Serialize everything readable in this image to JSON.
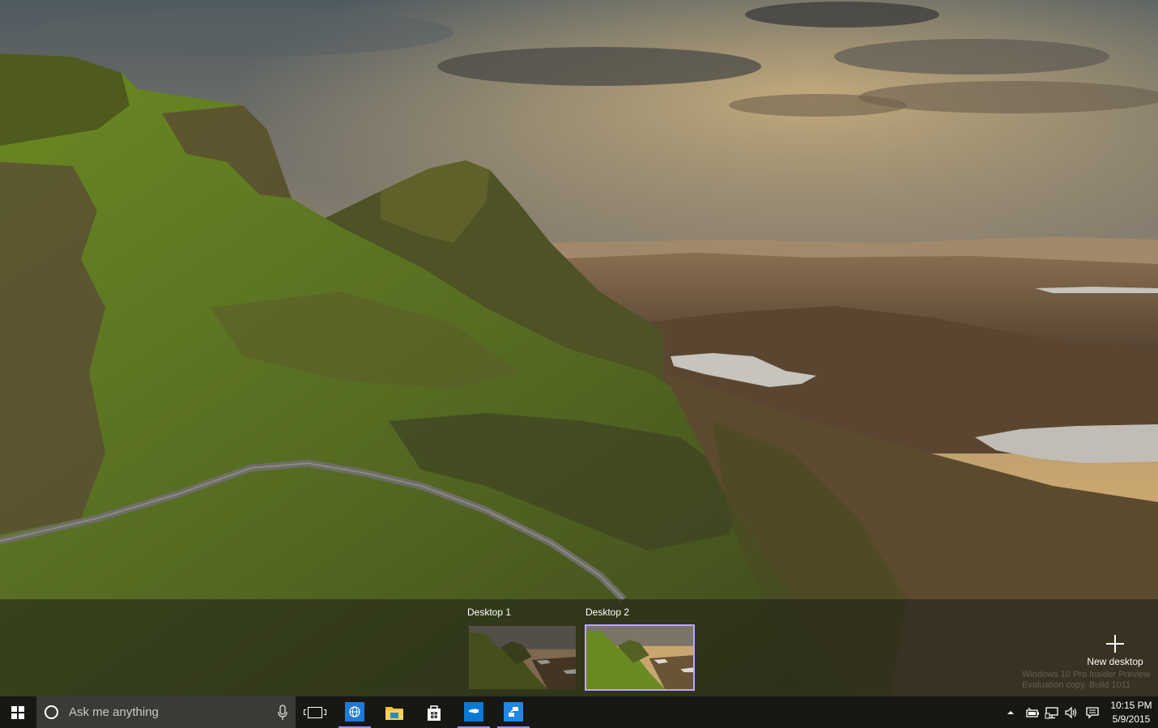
{
  "taskview": {
    "desktops": [
      {
        "label": "Desktop 1",
        "active": false
      },
      {
        "label": "Desktop 2",
        "active": true
      }
    ],
    "new_desktop_label": "New desktop"
  },
  "watermark": {
    "line1": "Windows 10 Pro Insider Preview",
    "line2": "Evaluation copy. Build 1011"
  },
  "taskbar": {
    "search_placeholder": "Ask me anything",
    "apps": [
      {
        "name": "browser",
        "color": "#1e7cd8",
        "icon": "globe-icon"
      },
      {
        "name": "file-explorer",
        "color": "#f2c12e",
        "icon": "folder-icon"
      },
      {
        "name": "store",
        "color": "#ffffff",
        "icon": "shopping-bag-icon"
      },
      {
        "name": "app-blue",
        "color": "#0a78d4",
        "icon": "screen-icon"
      },
      {
        "name": "app-remote",
        "color": "#1e88e5",
        "icon": "remote-icon"
      }
    ],
    "clock": {
      "time": "10:15 PM",
      "date": "5/9/2015"
    }
  },
  "colors": {
    "accent": "#b9a6ff",
    "taskbar": "#141412",
    "search_bg": "#3a3a36"
  }
}
